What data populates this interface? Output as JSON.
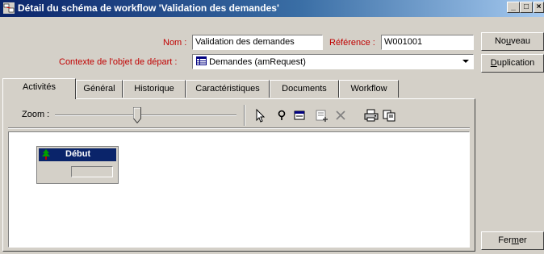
{
  "window": {
    "title": "Détail du schéma de workflow 'Validation des demandes'",
    "minimize": "_",
    "maximize": "□",
    "close": "×"
  },
  "form": {
    "name_label": "Nom :",
    "name_value": "Validation des demandes",
    "reference_label": "Référence :",
    "reference_value": "W001001",
    "context_label": "Contexte de l'objet de départ :",
    "context_value": "Demandes (amRequest)"
  },
  "side_buttons": {
    "new": {
      "before": "No",
      "accel": "u",
      "after": "veau"
    },
    "duplicate": {
      "before": "",
      "accel": "D",
      "after": "uplication"
    },
    "close": {
      "before": "Fer",
      "accel": "m",
      "after": "er"
    }
  },
  "tabs": [
    "Activités",
    "Général",
    "Historique",
    "Caractéristiques",
    "Documents",
    "Workflow"
  ],
  "active_tab": "Activités",
  "toolbar": {
    "zoom_label": "Zoom :",
    "zoom_level": 0.45
  },
  "node": {
    "title": "Début"
  },
  "colors": {
    "title_gradient_start": "#0a246a",
    "label_red": "#c00000",
    "face": "#d4d0c8"
  }
}
